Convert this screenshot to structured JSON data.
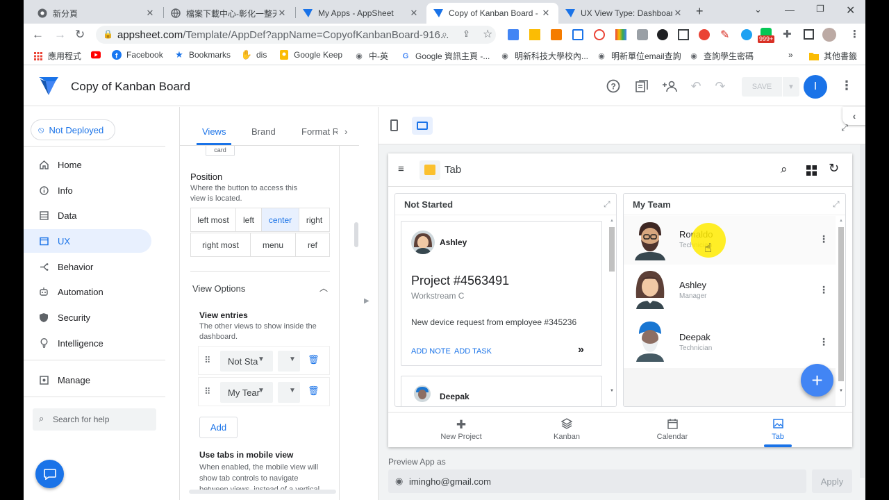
{
  "browser": {
    "tabs": [
      {
        "title": "新分頁",
        "icon": "chrome-icon"
      },
      {
        "title": "檔案下載中心-彰化一整天",
        "icon": "globe-icon"
      },
      {
        "title": "My Apps - AppSheet",
        "icon": "appsheet-icon"
      },
      {
        "title": "Copy of Kanban Board -",
        "icon": "appsheet-icon"
      },
      {
        "title": "UX View Type: Dashboard",
        "icon": "appsheet-icon"
      }
    ],
    "url_host": "appsheet.com",
    "url_path": "/Template/AppDef?appName=CopyofKanbanBoard-916...",
    "extension_badge": "999+",
    "profile_initial": "",
    "bookmarks": [
      {
        "label": "應用程式",
        "icon": "apps-grid-icon"
      },
      {
        "label": "",
        "icon": "youtube-icon"
      },
      {
        "label": "Facebook",
        "icon": "facebook-icon"
      },
      {
        "label": "Bookmarks",
        "icon": "star-icon"
      },
      {
        "label": "dis",
        "icon": "hand-icon"
      },
      {
        "label": "Google Keep",
        "icon": "keep-icon"
      },
      {
        "label": "中-英",
        "icon": "globe-icon"
      },
      {
        "label": "Google 資訊主頁 -...",
        "icon": "google-icon"
      },
      {
        "label": "明新科技大學校內...",
        "icon": "globe-icon"
      },
      {
        "label": "明新單位email查詢",
        "icon": "globe-icon"
      },
      {
        "label": "查詢學生密碼",
        "icon": "globe-icon"
      }
    ],
    "other_bookmarks": "其他書籤"
  },
  "app": {
    "title": "Copy of Kanban Board",
    "save_label": "SAVE",
    "user_initial": "I",
    "deploy_status": "Not Deployed"
  },
  "nav": {
    "items": [
      {
        "label": "Home",
        "icon": "home-icon"
      },
      {
        "label": "Info",
        "icon": "info-icon"
      },
      {
        "label": "Data",
        "icon": "data-icon"
      },
      {
        "label": "UX",
        "icon": "ux-icon"
      },
      {
        "label": "Behavior",
        "icon": "behavior-icon"
      },
      {
        "label": "Automation",
        "icon": "automation-icon"
      },
      {
        "label": "Security",
        "icon": "shield-icon"
      },
      {
        "label": "Intelligence",
        "icon": "bulb-icon"
      }
    ],
    "manage": "Manage",
    "search_placeholder": "Search for help"
  },
  "editor": {
    "tabs": [
      "Views",
      "Brand",
      "Format R"
    ],
    "chip_partial": "card",
    "position_title": "Position",
    "position_desc": "Where the button to access this view is located.",
    "positions": [
      "left most",
      "left",
      "center",
      "right",
      "right most",
      "menu",
      "ref"
    ],
    "selected_position": "center",
    "view_options": "View Options",
    "view_entries_title": "View entries",
    "view_entries_desc": "The other views to show inside the dashboard.",
    "entries": [
      "Not Sta",
      "My Tear"
    ],
    "add_label": "Add",
    "tabs_mobile_title": "Use tabs in mobile view",
    "tabs_mobile_desc": "When enabled, the mobile view will show tab controls to navigate between views, instead of a vertical"
  },
  "preview": {
    "app_title": "Tab",
    "col1_title": "Not Started",
    "col2_title": "My Team",
    "card": {
      "owner": "Ashley",
      "project": "Project #4563491",
      "workstream": "Workstream C",
      "description": "New device request from employee #345236",
      "action1": "ADD NOTE",
      "action2": "ADD TASK"
    },
    "card2_owner": "Deepak",
    "members": [
      {
        "name": "Ronaldo",
        "role": "Technician"
      },
      {
        "name": "Ashley",
        "role": "Manager"
      },
      {
        "name": "Deepak",
        "role": "Technician"
      }
    ],
    "bottom_nav": [
      {
        "label": "New Project",
        "icon": "plus-icon"
      },
      {
        "label": "Kanban",
        "icon": "layers-icon"
      },
      {
        "label": "Calendar",
        "icon": "calendar-icon"
      },
      {
        "label": "Tab",
        "icon": "image-icon"
      }
    ],
    "preview_as_label": "Preview App as",
    "preview_email": "imingho@gmail.com",
    "apply_label": "Apply"
  }
}
